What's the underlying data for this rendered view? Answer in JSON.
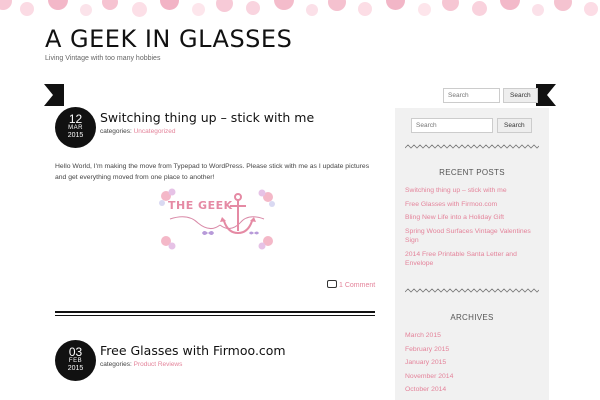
{
  "site": {
    "title": "A GEEK IN GLASSES",
    "tagline": "Living Vintage with too many hobbies"
  },
  "search": {
    "placeholder": "Search",
    "button_label": "Search"
  },
  "posts": [
    {
      "day": "12",
      "month": "MAR",
      "year": "2015",
      "title": "Switching thing up – stick with me",
      "categories_label": "categories:",
      "category": "Uncategorized",
      "body": "Hello World, I'm making the move from Typepad to WordPress. Please stick with me as I update pictures and get everything moved from one place to another!",
      "image_text": "THE GEEK",
      "comments": "1 Comment"
    },
    {
      "day": "03",
      "month": "FEB",
      "year": "2015",
      "title": "Free Glasses with Firmoo.com",
      "categories_label": "categories:",
      "category": "Product Reviews"
    }
  ],
  "sidebar": {
    "recent_posts_title": "RECENT POSTS",
    "recent_posts": [
      "Switching thing up – stick with me",
      "Free Glasses with Firmoo.com",
      "Bling New Life into a Holiday Gift",
      "Spring Wood Surfaces Vintage Valentines Sign",
      "2014 Free Printable Santa Letter and Envelope"
    ],
    "archives_title": "ARCHIVES",
    "archives": [
      "March 2015",
      "February 2015",
      "January 2015",
      "November 2014",
      "October 2014"
    ]
  },
  "colors": {
    "accent_pink": "#e4839a",
    "dark": "#111111",
    "sidebar_bg": "#f1f1f1"
  }
}
